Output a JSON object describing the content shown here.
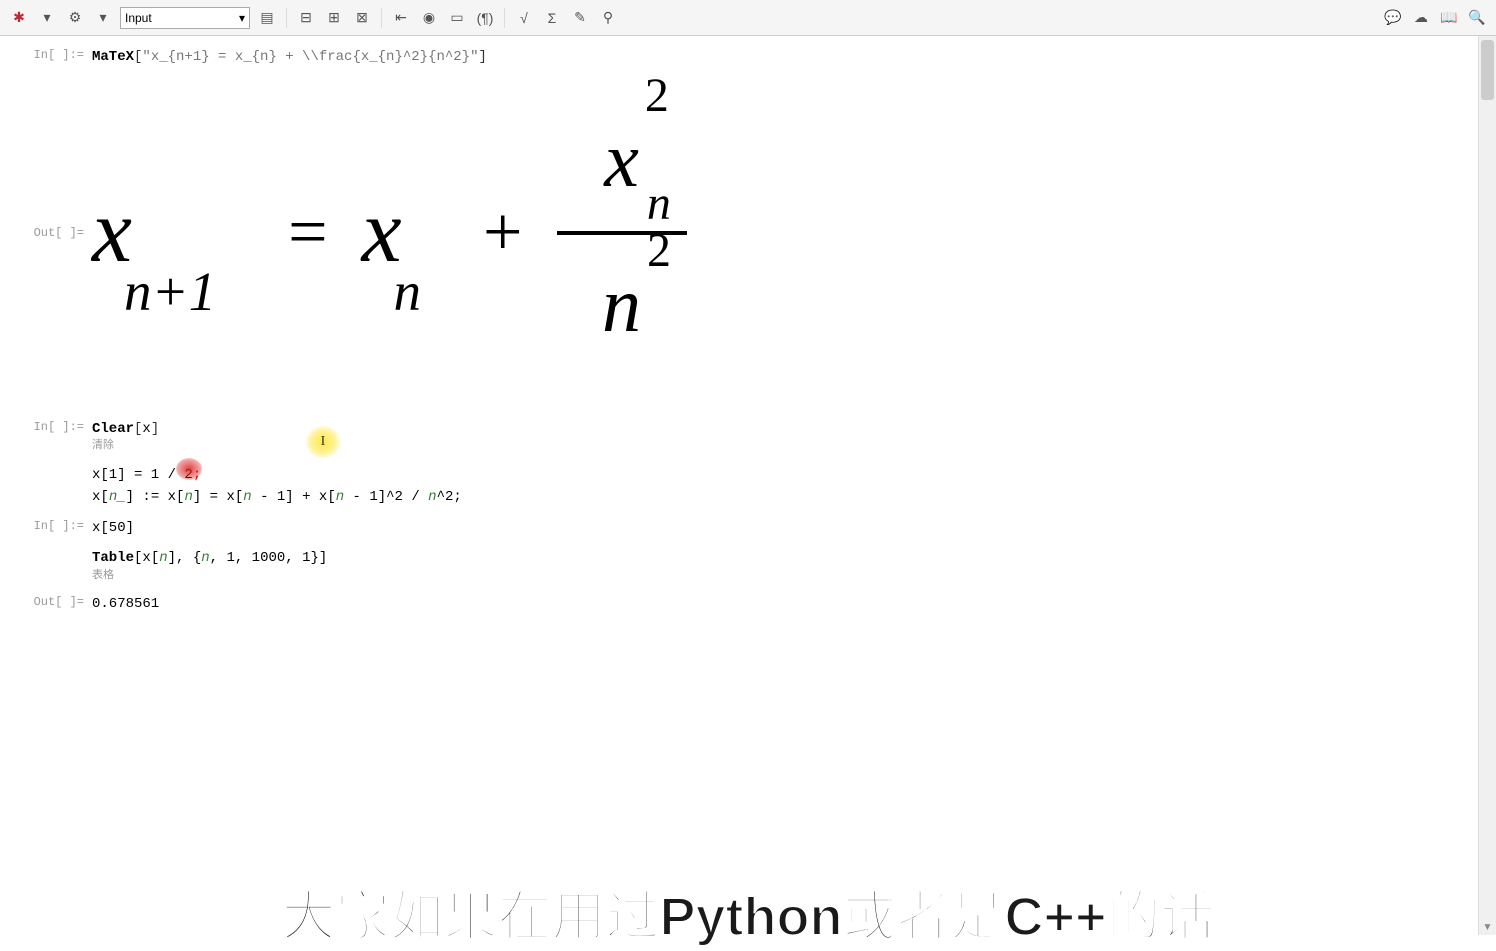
{
  "toolbar": {
    "format_dropdown": "Input"
  },
  "cells": {
    "in1_label": "In[  ]:=",
    "in1_code_func": "MaTeX",
    "in1_code_arg": "\"x_{n+1} = x_{n} + \\\\frac{x_{n}^2}{n^2}\"",
    "out1_label": "Out[  ]=",
    "formula_left_base": "x",
    "formula_left_sub": "n+1",
    "formula_eq": "=",
    "formula_mid_base": "x",
    "formula_mid_sub": "n",
    "formula_plus": "+",
    "formula_frac_top_base": "x",
    "formula_frac_top_sup": "2",
    "formula_frac_top_sub": "n",
    "formula_frac_bot_base": "n",
    "formula_frac_bot_sup": "2",
    "in2_label": "In[  ]:=",
    "in2_line1_func": "Clear",
    "in2_line1_arg": "x",
    "in2_line1_anno": "清除",
    "in2_line2": "x[1] = 1 / 2",
    "in2_line3_pre": "x[",
    "in2_line3_pat": "n_",
    "in2_line3_mid1": "] := ",
    "in2_line3_x1": "x",
    "in2_line3_b1": "[",
    "in2_line3_n1": "n",
    "in2_line3_b2": "]",
    "in2_line3_eq": " = ",
    "in2_line3_x2": "x",
    "in2_line3_b3": "[",
    "in2_line3_n2": "n",
    "in2_line3_m1": " - 1] + ",
    "in2_line3_x3": "x",
    "in2_line3_b4": "[",
    "in2_line3_n3": "n",
    "in2_line3_m2": " - 1]^2 / ",
    "in2_line3_n4": "n",
    "in2_line3_end": "^2;",
    "in3_label": "In[  ]:=",
    "in3_code": "x[50]",
    "in4_func": "Table",
    "in4_b1": "[",
    "in4_x": "x",
    "in4_b2": "[",
    "in4_n1": "n",
    "in4_mid": "], {",
    "in4_n2": "n",
    "in4_rest": ", 1, 1000, 1}]",
    "in4_anno": "表格",
    "out2_label": "Out[  ]=",
    "out2_value": "0.678561"
  },
  "subtitle": "大家如果在用过Python或者是C++的话"
}
